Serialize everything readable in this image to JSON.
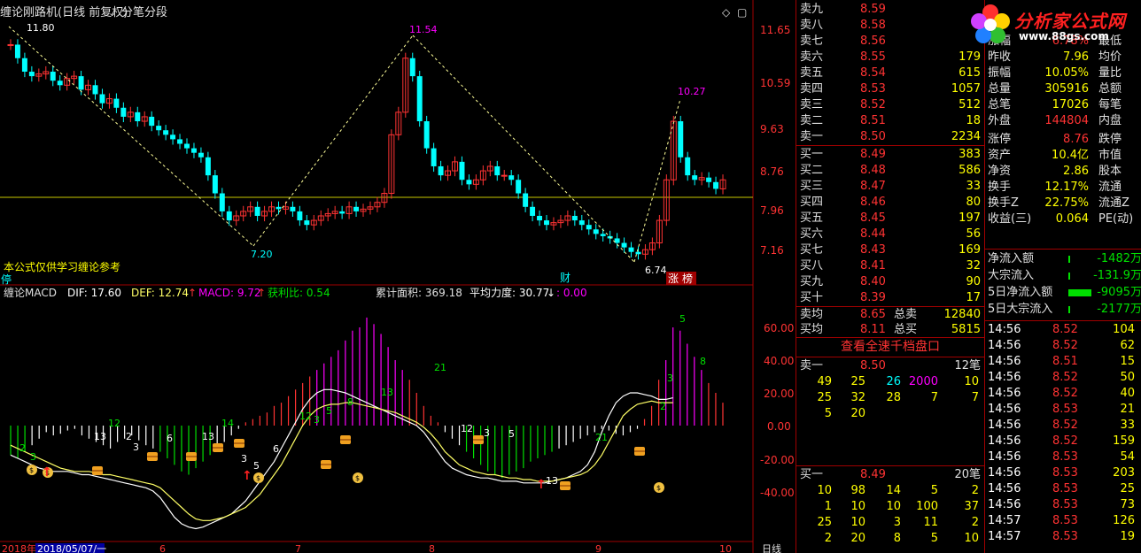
{
  "chart": {
    "title": "缠论刚路机(日线 前复权)",
    "indicator_toggle": "分笔分段",
    "note": "本公式仅供学习缠论参考",
    "stop_label": "停",
    "cai_label": "财",
    "zhang_label": "涨",
    "bang_label": "榜",
    "price_axis": [
      "11.65",
      "10.59",
      "9.63",
      "8.76",
      "7.96",
      "7.16"
    ],
    "peak_labels": [
      "11.80",
      "11.54",
      "10.27",
      "7.20",
      "6.74"
    ],
    "macd_header": {
      "name": "缠论MACD",
      "dif": "DIF: 17.60",
      "def": "DEF: 12.74",
      "macd": "MACD: 9.72",
      "profit": "获利比: 0.54",
      "area": "累计面积: 369.18",
      "avg": "平均力度: 30.77",
      "zero": ": 0.00"
    },
    "macd_axis": [
      "60.00",
      "40.00",
      "20.00",
      "0.00",
      "-20.00",
      "-40.00"
    ],
    "date_axis": [
      "2018年",
      "2018/05/07/一",
      "6",
      "7",
      "8",
      "9",
      "10",
      "日线"
    ],
    "bar_counts": [
      "2",
      "3",
      "13",
      "12",
      "2",
      "3",
      "6",
      "13",
      "14",
      "3",
      "5",
      "6",
      "12",
      "3",
      "5",
      "8",
      "13",
      "21",
      "12",
      "3",
      "5",
      "21",
      "13",
      "2",
      "3",
      "5",
      "8"
    ],
    "colors": {
      "up": "#ff3333",
      "down": "#00ffff",
      "axis": "#a00000",
      "dif": "#ffffff",
      "dea": "#ffff66",
      "bar_pos": "#ff00ff",
      "bar_neg": "#00e000"
    }
  },
  "quote": {
    "sells": [
      {
        "label": "卖九",
        "price": "8.59",
        "vol": ""
      },
      {
        "label": "卖八",
        "price": "8.58",
        "vol": ""
      },
      {
        "label": "卖七",
        "price": "8.56",
        "vol": ""
      },
      {
        "label": "卖六",
        "price": "8.55",
        "vol": "179"
      },
      {
        "label": "卖五",
        "price": "8.54",
        "vol": "615"
      },
      {
        "label": "卖四",
        "price": "8.53",
        "vol": "1057"
      },
      {
        "label": "卖三",
        "price": "8.52",
        "vol": "512"
      },
      {
        "label": "卖二",
        "price": "8.51",
        "vol": "18"
      },
      {
        "label": "卖一",
        "price": "8.50",
        "vol": "2234"
      }
    ],
    "buys": [
      {
        "label": "买一",
        "price": "8.49",
        "vol": "383"
      },
      {
        "label": "买二",
        "price": "8.48",
        "vol": "586"
      },
      {
        "label": "买三",
        "price": "8.47",
        "vol": "33"
      },
      {
        "label": "买四",
        "price": "8.46",
        "vol": "80"
      },
      {
        "label": "买五",
        "price": "8.45",
        "vol": "197"
      },
      {
        "label": "买六",
        "price": "8.44",
        "vol": "56"
      },
      {
        "label": "买七",
        "price": "8.43",
        "vol": "169"
      },
      {
        "label": "买八",
        "price": "8.41",
        "vol": "32"
      },
      {
        "label": "买九",
        "price": "8.40",
        "vol": "90"
      },
      {
        "label": "买十",
        "price": "8.39",
        "vol": "17"
      }
    ],
    "avg_sell": {
      "label": "卖均",
      "price": "8.65",
      "tlabel": "总卖",
      "tval": "12840"
    },
    "avg_buy": {
      "label": "买均",
      "price": "8.11",
      "tlabel": "总买",
      "tval": "5815"
    },
    "full_button": "查看全速千档盘口",
    "sell1_detail": {
      "label": "卖一",
      "price": "8.50",
      "count": "12笔",
      "rows": [
        [
          "49",
          "25",
          "26",
          "2000",
          "10"
        ],
        [
          "25",
          "32",
          "28",
          "7",
          "7"
        ],
        [
          "5",
          "20",
          "",
          "",
          ""
        ]
      ]
    },
    "buy1_detail": {
      "label": "买一",
      "price": "8.49",
      "count": "20笔",
      "rows": [
        [
          "10",
          "98",
          "14",
          "5",
          "2"
        ],
        [
          "1",
          "10",
          "10",
          "100",
          "37"
        ],
        [
          "25",
          "10",
          "3",
          "11",
          "2"
        ],
        [
          "2",
          "20",
          "8",
          "5",
          "10"
        ]
      ]
    }
  },
  "stats": [
    {
      "l1": "涨幅",
      "v1": "6.78%",
      "l2": "最低"
    },
    {
      "l1": "昨收",
      "v1": "7.96",
      "l2": "均价"
    },
    {
      "l1": "振幅",
      "v1": "10.05%",
      "l2": "量比"
    },
    {
      "l1": "总量",
      "v1": "305916",
      "l2": "总额"
    },
    {
      "l1": "总笔",
      "v1": "17026",
      "l2": "每笔"
    },
    {
      "l1": "外盘",
      "v1": "144804",
      "l2": "内盘"
    },
    {
      "l1": "涨停",
      "v1": "8.76",
      "l2": "跌停"
    },
    {
      "l1": "资产",
      "v1": "10.4亿",
      "l2": "市值"
    },
    {
      "l1": "净资",
      "v1": "2.86",
      "l2": "股本"
    },
    {
      "l1": "换手",
      "v1": "12.17%",
      "l2": "流通"
    },
    {
      "l1": "换手Z",
      "v1": "22.75%",
      "l2": "流通Z"
    },
    {
      "l1": "收益(三)",
      "v1": "0.064",
      "l2": "PE(动)"
    }
  ],
  "flows": [
    {
      "label": "净流入额",
      "value": "-1482万"
    },
    {
      "label": "大宗流入",
      "value": "-131.9万"
    },
    {
      "label": "5日净流入额",
      "value": "-9095万"
    },
    {
      "label": "5日大宗流入",
      "value": "-2177万"
    }
  ],
  "ticks": [
    {
      "time": "14:56",
      "price": "8.52",
      "vol": "104"
    },
    {
      "time": "14:56",
      "price": "8.52",
      "vol": "62"
    },
    {
      "time": "14:56",
      "price": "8.51",
      "vol": "15"
    },
    {
      "time": "14:56",
      "price": "8.52",
      "vol": "50"
    },
    {
      "time": "14:56",
      "price": "8.52",
      "vol": "40"
    },
    {
      "time": "14:56",
      "price": "8.53",
      "vol": "21"
    },
    {
      "time": "14:56",
      "price": "8.52",
      "vol": "33"
    },
    {
      "time": "14:56",
      "price": "8.52",
      "vol": "159"
    },
    {
      "time": "14:56",
      "price": "8.53",
      "vol": "54"
    },
    {
      "time": "14:56",
      "price": "8.53",
      "vol": "203"
    },
    {
      "time": "14:56",
      "price": "8.53",
      "vol": "25"
    },
    {
      "time": "14:56",
      "price": "8.53",
      "vol": "73"
    },
    {
      "time": "14:57",
      "price": "8.53",
      "vol": "126"
    },
    {
      "time": "14:57",
      "price": "8.53",
      "vol": "19"
    }
  ],
  "logo": {
    "text": "分析家公式网",
    "url": "www.88gs.com"
  }
}
